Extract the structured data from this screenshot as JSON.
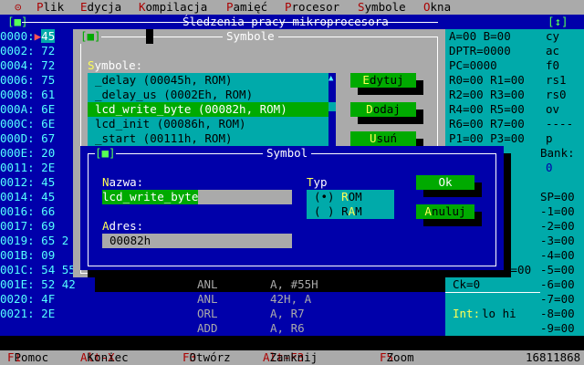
{
  "menu": {
    "sys": "⊝",
    "items": [
      {
        "hot": "P",
        "rest": "lik"
      },
      {
        "hot": "E",
        "rest": "dycja"
      },
      {
        "hot": "K",
        "rest": "ompilacja"
      },
      {
        "hot": "P",
        "rest": "amięć"
      },
      {
        "hot": "P",
        "rest": "rocesor"
      },
      {
        "hot": "S",
        "rest": "ymbole"
      },
      {
        "hot": "O",
        "rest": "kna"
      }
    ]
  },
  "main_window": {
    "title": "Śledzenia pracy mikroprocesora",
    "left_ctrl": "[■]",
    "right_ctrl": "[↕]"
  },
  "code_rows": [
    {
      "addr": "0000:",
      "data": "45"
    },
    {
      "addr": "0002:",
      "data": "72"
    },
    {
      "addr": "0004:",
      "data": "72"
    },
    {
      "addr": "0006:",
      "data": "75"
    },
    {
      "addr": "0008:",
      "data": "61"
    },
    {
      "addr": "000A:",
      "data": "6E"
    },
    {
      "addr": "000C:",
      "data": "6E"
    },
    {
      "addr": "000D:",
      "data": "67"
    },
    {
      "addr": "000E:",
      "data": "20"
    },
    {
      "addr": "0011:",
      "data": "2E"
    },
    {
      "addr": "0012:",
      "data": "45"
    },
    {
      "addr": "0014:",
      "data": "45"
    },
    {
      "addr": "0016:",
      "data": "66"
    },
    {
      "addr": "0017:",
      "data": "69"
    },
    {
      "addr": "0019:",
      "data": "65 2"
    },
    {
      "addr": "001B:",
      "data": "09"
    },
    {
      "addr": "001C:",
      "data": "54 55"
    },
    {
      "addr": "001E:",
      "data": "52 42"
    },
    {
      "addr": "0020:",
      "data": "4F"
    },
    {
      "addr": "0021:",
      "data": "2E"
    }
  ],
  "disasm": [
    {
      "op": "ANL",
      "arg": "A, #55H"
    },
    {
      "op": "ANL",
      "arg": "42H, A"
    },
    {
      "op": "ORL",
      "arg": "A, R7"
    },
    {
      "op": "ADD",
      "arg": "A, R6"
    }
  ],
  "registers": [
    "A=00 B=00",
    "DPTR=0000",
    "PC=0000",
    "R0=00 R1=00",
    "R2=00 R3=00",
    "R4=00 R5=00",
    "R6=00 R7=00",
    "P1=00 P3=00"
  ],
  "reg_misc": {
    "p_equals": "P=00",
    "ck": "Ck=0",
    "int_label": "Int:",
    "int_value": "lo hi"
  },
  "flags": [
    "cy",
    "ac",
    "f0",
    "rs1",
    "rs0",
    "ov",
    "----",
    "p"
  ],
  "bank": {
    "label": "Bank:",
    "value": "0"
  },
  "stack": [
    "SP=00",
    "-1=00",
    "-2=00",
    "-3=00",
    "-4=00",
    "-5=00",
    "-6=00",
    "-7=00",
    "-8=00",
    "-9=00"
  ],
  "symbols_dialog": {
    "title": "Symbole",
    "ctrl": "[■]",
    "label_hot": "S",
    "label_rest": "ymbole:",
    "items": [
      "_delay (00045h, ROM)",
      "_delay_us (0002Eh, ROM)",
      "lcd_write_byte (00082h, ROM)",
      "lcd_init (00086h, ROM)",
      "_start (00111h, ROM)"
    ],
    "selected_index": 2,
    "buttons": [
      {
        "hot": "E",
        "rest": "dytuj",
        "pre": ""
      },
      {
        "hot": "D",
        "rest": "odaj",
        "pre": ""
      },
      {
        "hot": "U",
        "rest": "suń",
        "pre": ""
      }
    ]
  },
  "symbol_dialog": {
    "title": "Symbol",
    "ctrl": "[■]",
    "name_label_hot": "N",
    "name_label_rest": "azwa:",
    "name_value": "lcd_write_byte",
    "addr_label_hot": "A",
    "addr_label_rest": "dres:",
    "addr_value": "00082h",
    "type_label_hot": "T",
    "type_label_rest": "yp",
    "options": [
      {
        "mark": "(•)",
        "hot": "R",
        "rest": "OM"
      },
      {
        "mark": "( )",
        "pre": "R",
        "hot": "A",
        "rest": "M"
      }
    ],
    "ok": "Ok",
    "cancel_hot": "A",
    "cancel_rest": "nuluj"
  },
  "status": {
    "items": [
      {
        "key": "F1",
        "label": "Pomoc"
      },
      {
        "key": "Alt-X",
        "label": "Koniec"
      },
      {
        "key": "F3",
        "label": "Otwórz"
      },
      {
        "key": "Alt-F3",
        "label": "Zamknij"
      },
      {
        "key": "F5",
        "label": "Zoom"
      }
    ],
    "memory": "16811868"
  },
  "colors": {
    "desktop": "#0000aa",
    "panel": "#00aaaa",
    "dialog": "#aaaaaa",
    "button": "#00aa00",
    "hotkey": "#aa0000",
    "highlight": "#ffff55"
  }
}
